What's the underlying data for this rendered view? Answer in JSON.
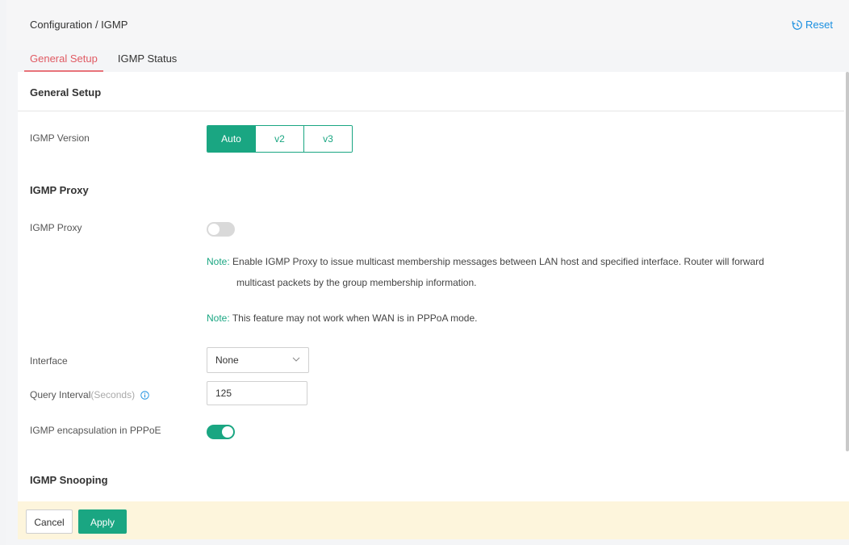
{
  "header": {
    "breadcrumb": "Configuration / IGMP",
    "reset_label": "Reset"
  },
  "tabs": [
    {
      "label": "General Setup",
      "active": true
    },
    {
      "label": "IGMP Status",
      "active": false
    }
  ],
  "general_setup": {
    "title": "General Setup",
    "igmp_version": {
      "label": "IGMP Version",
      "options": [
        "Auto",
        "v2",
        "v3"
      ],
      "selected": "Auto"
    }
  },
  "igmp_proxy": {
    "title": "IGMP Proxy",
    "proxy_label": "IGMP Proxy",
    "proxy_enabled": false,
    "note1_tag": "Note:",
    "note1_line1": "Enable IGMP Proxy to issue multicast membership messages between LAN host and specified interface. Router will forward",
    "note1_line2": "multicast packets by the group membership information.",
    "note2_tag": "Note:",
    "note2_text": "This feature may not work when WAN is in PPPoA mode.",
    "interface_label": "Interface",
    "interface_value": "None",
    "query_interval_label": "Query Interval",
    "query_interval_unit": "(Seconds)",
    "query_interval_value": "125",
    "pppoe_label": "IGMP encapsulation in PPPoE",
    "pppoe_enabled": true
  },
  "igmp_snooping": {
    "title": "IGMP Snooping"
  },
  "footer": {
    "cancel_label": "Cancel",
    "apply_label": "Apply"
  },
  "colors": {
    "accent": "#1aa682",
    "active_tab": "#e05a63",
    "link": "#1a8fe0",
    "footer_bg": "#fdf5dc"
  },
  "icons": {
    "reset": "history-icon",
    "info": "info-icon",
    "dropdown": "chevron-down-icon"
  }
}
